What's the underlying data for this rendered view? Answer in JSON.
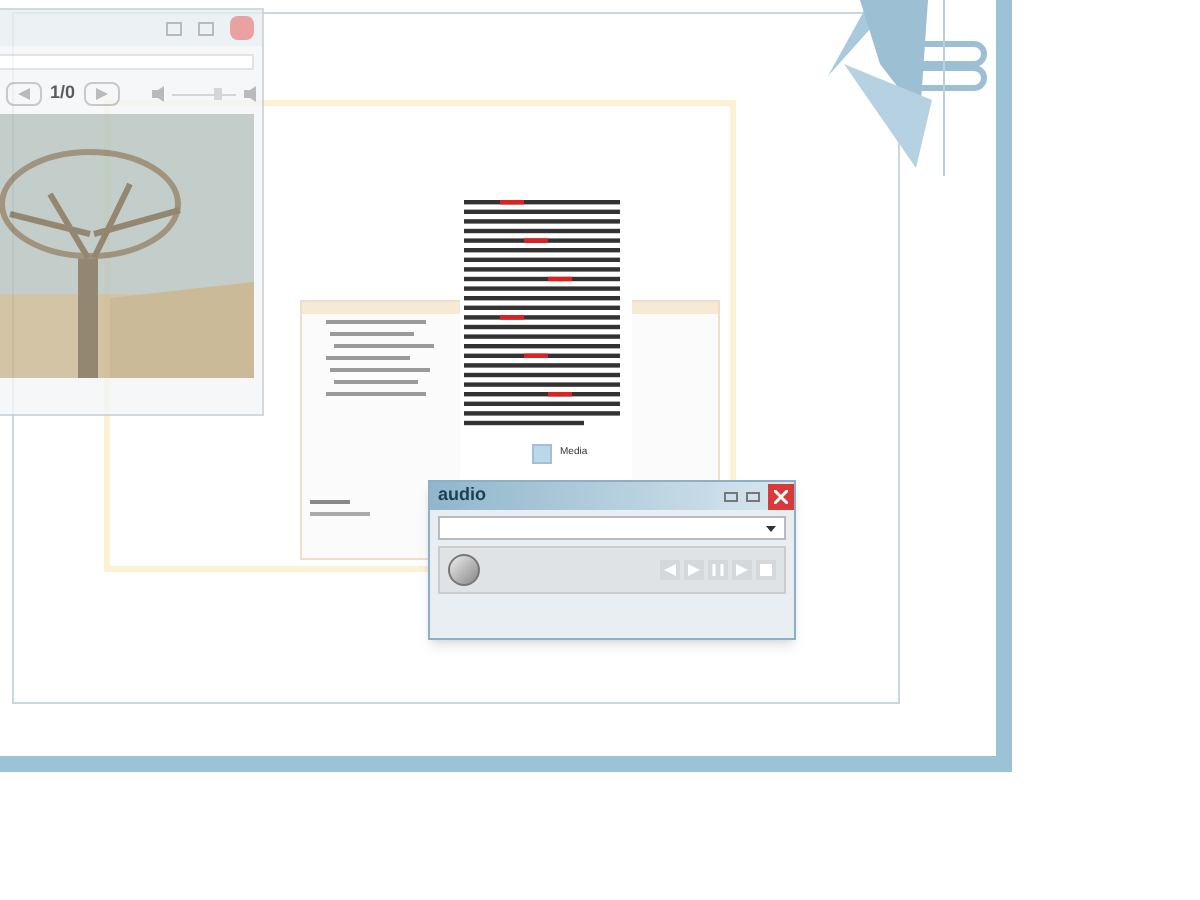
{
  "image_viewer": {
    "counter": "1/0",
    "volume": {
      "level": 0.8
    }
  },
  "document": {
    "media_label": "Media"
  },
  "audio_window": {
    "title": "audio"
  }
}
